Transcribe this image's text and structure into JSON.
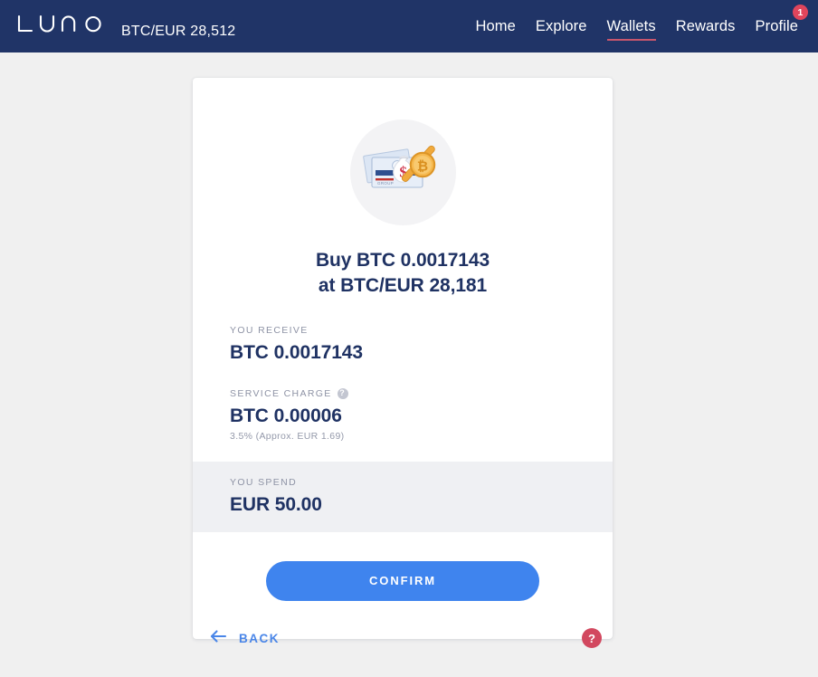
{
  "header": {
    "logo_text": "LUNO",
    "market_pair": "BTC/EUR 28,512",
    "nav": [
      {
        "label": "Home",
        "active": false
      },
      {
        "label": "Explore",
        "active": false
      },
      {
        "label": "Wallets",
        "active": true
      },
      {
        "label": "Rewards",
        "active": false
      },
      {
        "label": "Profile",
        "active": false,
        "badge": "1"
      }
    ],
    "colors": {
      "background": "#203467",
      "active_underline": "#c8566d",
      "badge": "#e0455c"
    }
  },
  "card": {
    "illustration": {
      "name": "buy-crypto-illustration",
      "circle_background": "#f3f3f5",
      "elements": [
        "banknotes",
        "money-bag-dollar",
        "magnifying-glass-bitcoin"
      ]
    },
    "headline_line1": "Buy BTC 0.0017143",
    "headline_line2": "at BTC/EUR 28,181",
    "fields": {
      "receive_label": "YOU RECEIVE",
      "receive_value": "BTC 0.0017143",
      "service_label": "SERVICE CHARGE",
      "service_help_glyph": "?",
      "service_value": "BTC 0.00006",
      "service_note": "3.5% (Approx. EUR 1.69)",
      "spend_label": "YOU SPEND",
      "spend_value": "EUR 50.00"
    },
    "confirm_label": "CONFIRM",
    "confirm_color": "#3f84ee"
  },
  "footer": {
    "back_label": "BACK",
    "back_color": "#4a86e8",
    "help_glyph": "?",
    "help_color": "#d2485f"
  }
}
